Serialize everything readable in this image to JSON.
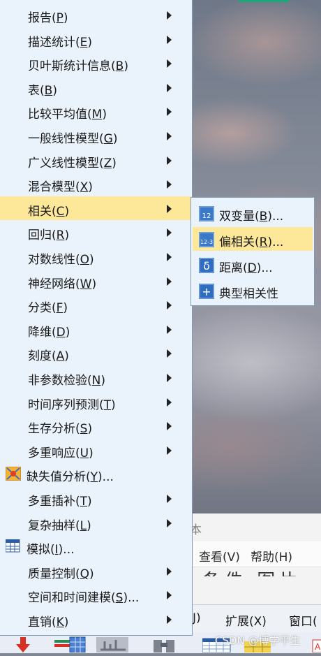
{
  "main_menu": {
    "items": [
      {
        "label": "报告(P)",
        "has_submenu": true
      },
      {
        "label": "描述统计(E)",
        "has_submenu": true
      },
      {
        "label": "贝叶斯统计信息(B)",
        "has_submenu": true
      },
      {
        "label": "表(B)",
        "has_submenu": true
      },
      {
        "label": "比较平均值(M)",
        "has_submenu": true
      },
      {
        "label": "一般线性模型(G)",
        "has_submenu": true
      },
      {
        "label": "广义线性模型(Z)",
        "has_submenu": true
      },
      {
        "label": "混合模型(X)",
        "has_submenu": true
      },
      {
        "label": "相关(C)",
        "has_submenu": true,
        "highlighted": true
      },
      {
        "label": "回归(R)",
        "has_submenu": true
      },
      {
        "label": "对数线性(O)",
        "has_submenu": true
      },
      {
        "label": "神经网络(W)",
        "has_submenu": true
      },
      {
        "label": "分类(F)",
        "has_submenu": true
      },
      {
        "label": "降维(D)",
        "has_submenu": true
      },
      {
        "label": "刻度(A)",
        "has_submenu": true
      },
      {
        "label": "非参数检验(N)",
        "has_submenu": true
      },
      {
        "label": "时间序列预测(T)",
        "has_submenu": true
      },
      {
        "label": "生存分析(S)",
        "has_submenu": true
      },
      {
        "label": "多重响应(U)",
        "has_submenu": true
      },
      {
        "label": "缺失值分析(Y)...",
        "has_submenu": false,
        "icon": "missing-value-icon"
      },
      {
        "label": "多重插补(T)",
        "has_submenu": true
      },
      {
        "label": "复杂抽样(L)",
        "has_submenu": true
      },
      {
        "label": "模拟(I)...",
        "has_submenu": false,
        "icon": "simulation-icon"
      },
      {
        "label": "质量控制(Q)",
        "has_submenu": true
      },
      {
        "label": "空间和时间建模(S)...",
        "has_submenu": true
      },
      {
        "label": "直销(K)",
        "has_submenu": true
      }
    ]
  },
  "correlate_submenu": {
    "items": [
      {
        "label": "双变量(B)...",
        "icon": "bivariate-icon",
        "icon_text": "12"
      },
      {
        "label": "偏相关(R)...",
        "icon": "partial-correlation-icon",
        "icon_text": "12-3",
        "highlighted": true
      },
      {
        "label": "距离(D)...",
        "icon": "distance-icon",
        "icon_text": "δ"
      },
      {
        "label": "典型相关性",
        "icon": "canonical-correlation-icon",
        "icon_text": "+"
      }
    ]
  },
  "background_window": {
    "title_fragment": "本",
    "menubar": [
      "查看(V)",
      "帮助(H)"
    ],
    "menubar2": [
      "J)",
      "扩展(X)",
      "窗口("
    ],
    "text_fragment": "条件 图片"
  },
  "watermark": "CSDN @博学平生",
  "colors": {
    "menu_bg": "#eaf2fb",
    "highlight": "#fde89a",
    "border": "#7f9db9"
  }
}
